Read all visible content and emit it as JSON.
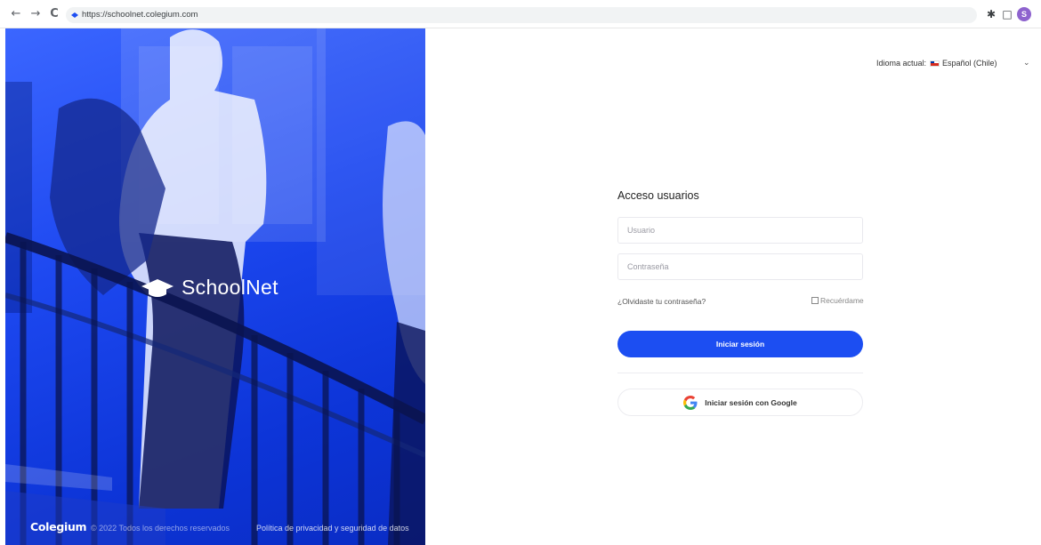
{
  "browser": {
    "url": "https://schoolnet.colegium.com",
    "profile_initial": "S",
    "nav": {
      "back": "←",
      "forward": "→",
      "reload": "C"
    },
    "extensions": {
      "puzzle": "✱",
      "sidepanel": "□"
    }
  },
  "hero": {
    "app_name": "SchoolNet",
    "brand": "Colegium",
    "copyright": "© 2022  Todos los derechos reservados",
    "privacy_link": "Política de privacidad y seguridad de datos"
  },
  "language": {
    "label": "Idioma actual:",
    "value": "Español (Chile)",
    "chevron": "⌄"
  },
  "login": {
    "title": "Acceso usuarios",
    "username_placeholder": "Usuario",
    "password_placeholder": "Contraseña",
    "forgot": "¿Olvidaste tu contraseña?",
    "remember": "Recuérdame",
    "submit": "Iniciar sesión",
    "google": "Iniciar sesión con Google"
  },
  "colors": {
    "primary": "#1c4ef2",
    "hero_blue": "#1d48f0",
    "profile": "#8e63ce"
  }
}
